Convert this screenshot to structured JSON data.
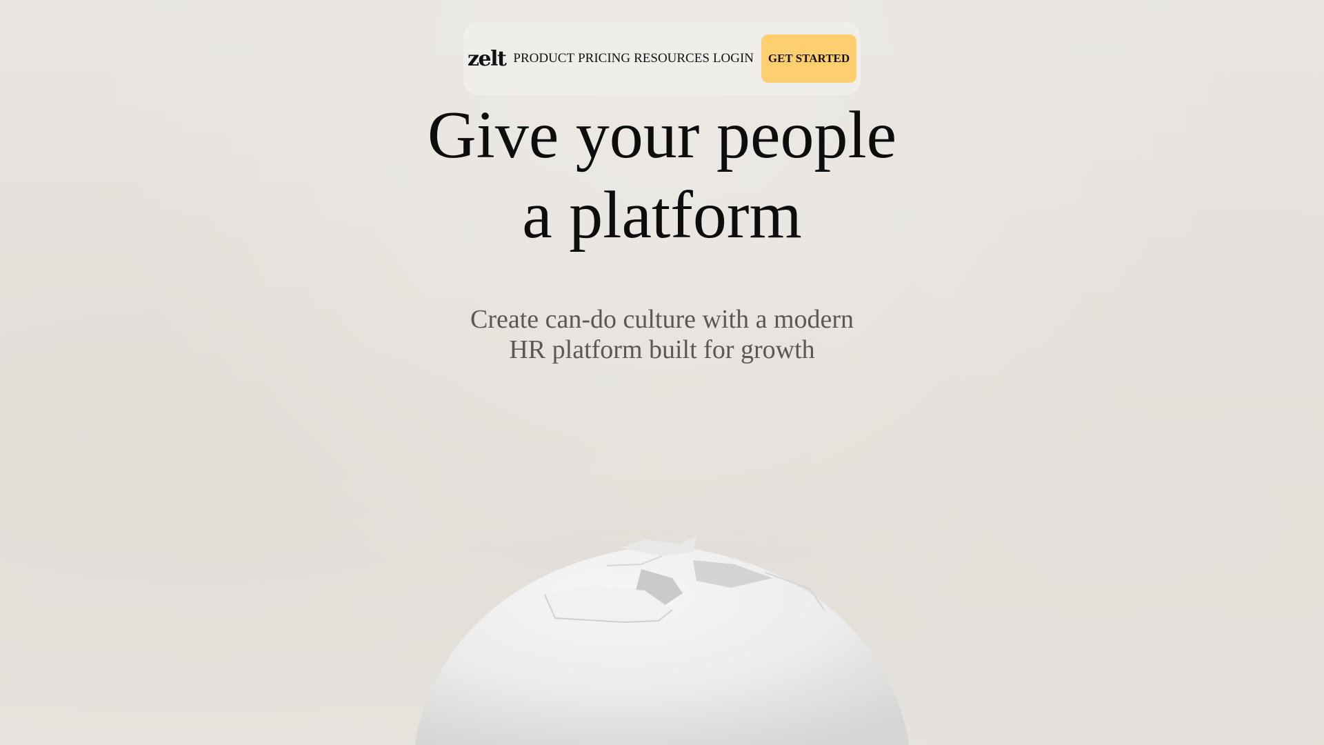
{
  "brand": {
    "logo_text": "zelt"
  },
  "nav": {
    "items": [
      {
        "label": "PRODUCT"
      },
      {
        "label": "PRICING"
      },
      {
        "label": "RESOURCES"
      },
      {
        "label": "LOGIN"
      }
    ],
    "cta_label": "GET STARTED"
  },
  "hero": {
    "headline_line1": "Give your people",
    "headline_line2": "a platform",
    "subhead_line1": "Create can-do culture with a modern",
    "subhead_line2": "HR platform built for growth"
  },
  "colors": {
    "background": "#e6e2dd",
    "cta": "#fecf6f",
    "headline": "#0d0d0d",
    "subhead": "#5a5754"
  },
  "illustration": {
    "icon": "cracked-egg-image"
  }
}
